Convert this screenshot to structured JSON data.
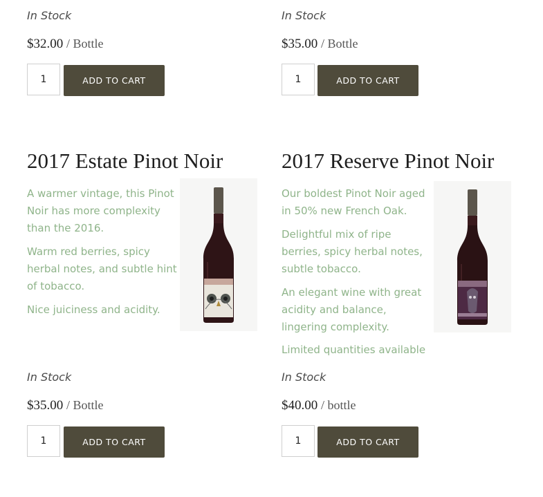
{
  "top_row": [
    {
      "stock": "In Stock",
      "price": "$32.00",
      "unit": "/ Bottle",
      "qty": "1",
      "cart_label": "ADD TO CART"
    },
    {
      "stock": "In Stock",
      "price": "$35.00",
      "unit": "/ Bottle",
      "qty": "1",
      "cart_label": "ADD TO CART"
    }
  ],
  "products": [
    {
      "title": "2017 Estate Pinot Noir",
      "paragraphs": [
        "A warmer vintage, this Pinot Noir has more complexity than the 2016.",
        "Warm red berries, spicy herbal notes, and subtle hint of tobacco.",
        "Nice juiciness and acidity."
      ],
      "image_icon": "wine-bottle-owl-label",
      "stock": "In Stock",
      "price": "$35.00",
      "unit": "/ Bottle",
      "qty": "1",
      "cart_label": "ADD TO CART"
    },
    {
      "title": "2017 Reserve Pinot Noir",
      "paragraphs": [
        "Our boldest Pinot Noir aged in 50% new French Oak.",
        "Delightful  mix of ripe berries, spicy herbal notes, subtle tobacco.",
        "An elegant wine with great acidity and balance, lingering complexity.",
        "Limited quantities available"
      ],
      "image_icon": "wine-bottle-purple-label",
      "stock": "In Stock",
      "price": "$40.00",
      "unit": "/ bottle",
      "qty": "1",
      "cart_label": "ADD TO CART"
    }
  ],
  "colors": {
    "accent_text": "#8fb48a",
    "button_bg": "#4f4b3b"
  }
}
